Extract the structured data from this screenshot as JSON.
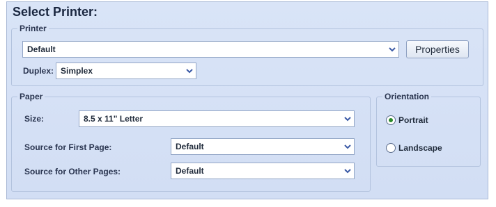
{
  "title": "Select Printer:",
  "printer": {
    "legend": "Printer",
    "selected": "Default",
    "properties_label": "Properties",
    "duplex_label": "Duplex:",
    "duplex_value": "Simplex"
  },
  "paper": {
    "legend": "Paper",
    "size_label": "Size:",
    "size_value": "8.5 x 11\" Letter",
    "first_page_label": "Source for First Page:",
    "first_page_value": "Default",
    "other_pages_label": "Source for Other Pages:",
    "other_pages_value": "Default"
  },
  "orientation": {
    "legend": "Orientation",
    "portrait_label": "Portrait",
    "landscape_label": "Landscape",
    "selected": "Portrait"
  },
  "icons": {
    "dropdown": "chevron-down-icon"
  }
}
